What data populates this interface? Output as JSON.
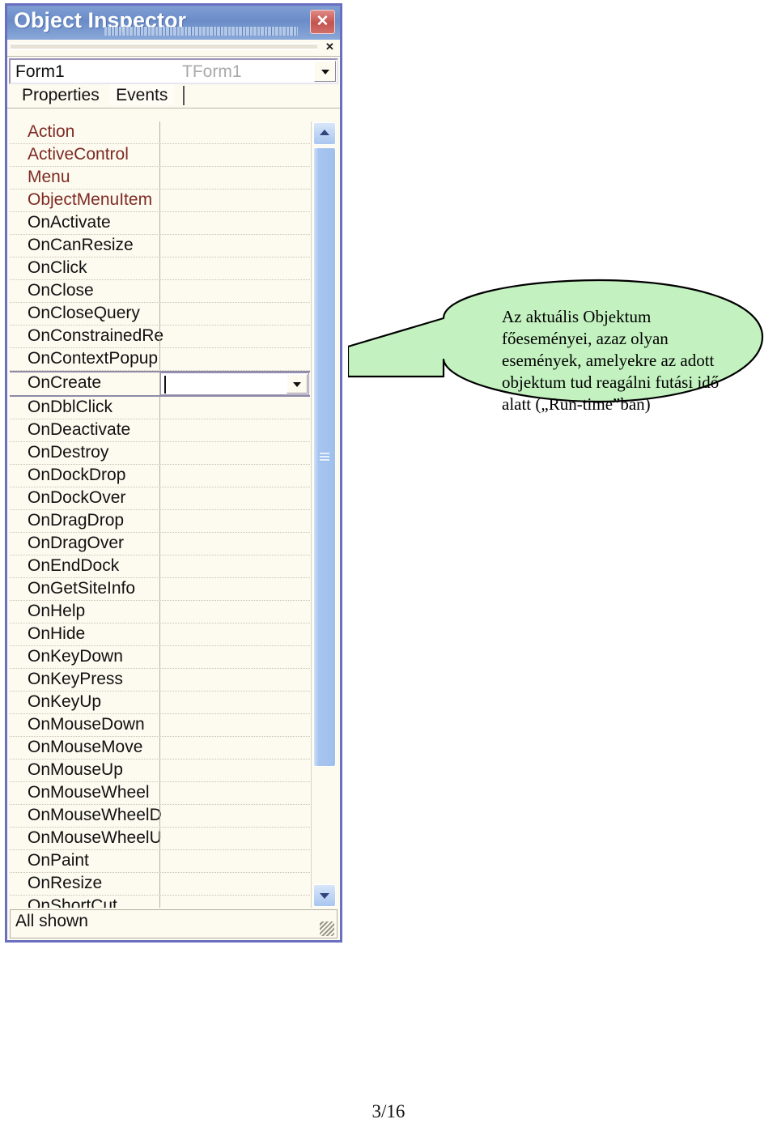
{
  "window": {
    "title": "Object Inspector",
    "close_label": "✕",
    "toolstrip_close_label": "✕"
  },
  "object_selector": {
    "name": "Form1",
    "class": "TForm1",
    "dropdown_icon": "chevron-down-icon"
  },
  "tabs": [
    {
      "label": "Properties",
      "active": false
    },
    {
      "label": "Events",
      "active": true
    }
  ],
  "grid": {
    "rows": [
      {
        "name": "Action",
        "kind": "property",
        "value": ""
      },
      {
        "name": "ActiveControl",
        "kind": "property",
        "value": ""
      },
      {
        "name": "Menu",
        "kind": "property",
        "value": ""
      },
      {
        "name": "ObjectMenuItem",
        "kind": "property",
        "value": ""
      },
      {
        "name": "OnActivate",
        "kind": "event",
        "value": ""
      },
      {
        "name": "OnCanResize",
        "kind": "event",
        "value": ""
      },
      {
        "name": "OnClick",
        "kind": "event",
        "value": ""
      },
      {
        "name": "OnClose",
        "kind": "event",
        "value": ""
      },
      {
        "name": "OnCloseQuery",
        "kind": "event",
        "value": ""
      },
      {
        "name": "OnConstrainedRe",
        "kind": "event",
        "value": ""
      },
      {
        "name": "OnContextPopup",
        "kind": "event",
        "value": ""
      },
      {
        "name": "OnCreate",
        "kind": "event",
        "value": "",
        "selected": true
      },
      {
        "name": "OnDblClick",
        "kind": "event",
        "value": ""
      },
      {
        "name": "OnDeactivate",
        "kind": "event",
        "value": ""
      },
      {
        "name": "OnDestroy",
        "kind": "event",
        "value": ""
      },
      {
        "name": "OnDockDrop",
        "kind": "event",
        "value": ""
      },
      {
        "name": "OnDockOver",
        "kind": "event",
        "value": ""
      },
      {
        "name": "OnDragDrop",
        "kind": "event",
        "value": ""
      },
      {
        "name": "OnDragOver",
        "kind": "event",
        "value": ""
      },
      {
        "name": "OnEndDock",
        "kind": "event",
        "value": ""
      },
      {
        "name": "OnGetSiteInfo",
        "kind": "event",
        "value": ""
      },
      {
        "name": "OnHelp",
        "kind": "event",
        "value": ""
      },
      {
        "name": "OnHide",
        "kind": "event",
        "value": ""
      },
      {
        "name": "OnKeyDown",
        "kind": "event",
        "value": ""
      },
      {
        "name": "OnKeyPress",
        "kind": "event",
        "value": ""
      },
      {
        "name": "OnKeyUp",
        "kind": "event",
        "value": ""
      },
      {
        "name": "OnMouseDown",
        "kind": "event",
        "value": ""
      },
      {
        "name": "OnMouseMove",
        "kind": "event",
        "value": ""
      },
      {
        "name": "OnMouseUp",
        "kind": "event",
        "value": ""
      },
      {
        "name": "OnMouseWheel",
        "kind": "event",
        "value": ""
      },
      {
        "name": "OnMouseWheelD",
        "kind": "event",
        "value": ""
      },
      {
        "name": "OnMouseWheelU",
        "kind": "event",
        "value": ""
      },
      {
        "name": "OnPaint",
        "kind": "event",
        "value": ""
      },
      {
        "name": "OnResize",
        "kind": "event",
        "value": ""
      },
      {
        "name": "OnShortCut",
        "kind": "event",
        "value": ""
      }
    ]
  },
  "scrollbar": {
    "up_icon": "chevron-up-icon",
    "down_icon": "chevron-down-icon"
  },
  "status_bar": {
    "text": "All shown"
  },
  "callout": {
    "lines": [
      "Az aktuális Objektum",
      "főeseményei, azaz olyan",
      "események, amelyekre az adott",
      "objektum tud reagálni futási idő",
      "alatt („Run-time”ban)"
    ],
    "fill_color": "#c3f2c0",
    "stroke_color": "#000000"
  },
  "footer": {
    "page": "3/16"
  },
  "colors": {
    "titlebar": "#6a8cc8",
    "close_button": "#c4534e",
    "property_text": "#7d2b23",
    "event_text": "#111111",
    "window_bg": "#fdfaf0",
    "window_border": "#6b6fc0",
    "scrollbar_thumb": "#a6c4ee"
  }
}
